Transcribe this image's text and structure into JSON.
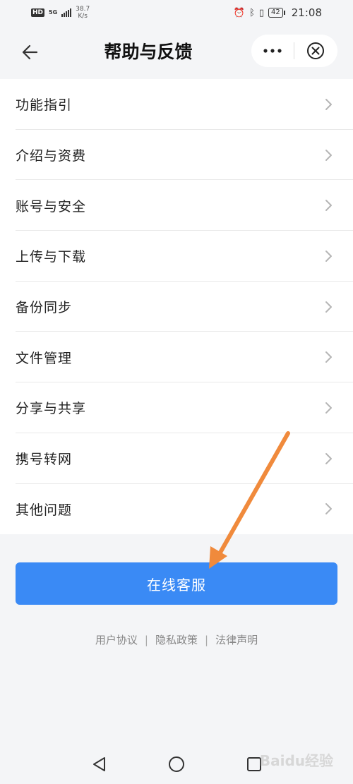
{
  "status_bar": {
    "hd": "HD",
    "network": "5G",
    "speed_value": "38.7",
    "speed_unit": "K/s",
    "battery": "42",
    "time": "21:08"
  },
  "header": {
    "title": "帮助与反馈"
  },
  "menu": {
    "items": [
      {
        "label": "功能指引"
      },
      {
        "label": "介绍与资费"
      },
      {
        "label": "账号与安全"
      },
      {
        "label": "上传与下载"
      },
      {
        "label": "备份同步"
      },
      {
        "label": "文件管理"
      },
      {
        "label": "分享与共享"
      },
      {
        "label": "携号转网"
      },
      {
        "label": "其他问题"
      }
    ]
  },
  "service_button": {
    "label": "在线客服"
  },
  "footer": {
    "user_agreement": "用户协议",
    "privacy_policy": "隐私政策",
    "legal_notice": "法律声明",
    "separator": "|"
  },
  "watermark": "Baidu经验",
  "colors": {
    "accent": "#3a8af5",
    "annotation_arrow": "#f08a3c",
    "background": "#f4f5f7"
  }
}
